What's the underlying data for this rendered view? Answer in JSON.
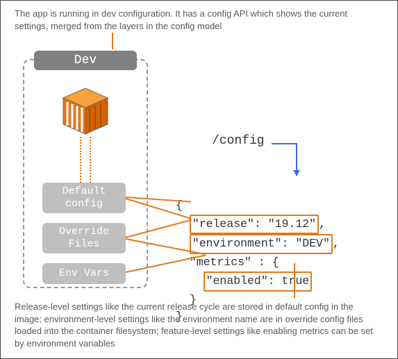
{
  "captions": {
    "top": "The app is running in dev configuration. It has a config API which shows the current settings, merged from the layers in the config model",
    "bottom": "Release-level settings like the current release cycle are stored in default config in the image; environment-level settings like the environment name are in override config files loaded into the container filesystem; feature-level settings like enabling metrics can be set by environment variables"
  },
  "labels": {
    "dev": "Dev",
    "default_config": "Default config",
    "override_files": "Override Files",
    "env_vars": "Env Vars",
    "endpoint": "/config"
  },
  "json": {
    "open": "{",
    "release": "\"release\": \"19.12\"",
    "release_comma": ",",
    "environment": "\"environment\": \"DEV\"",
    "environment_comma": ",",
    "metrics": "\"metrics\" : {",
    "enabled": "\"enabled\": true",
    "metrics_close": "}",
    "close": "}"
  },
  "colors": {
    "accent": "#e67817",
    "pill": "#bfbfbf",
    "devpill": "#808080",
    "blue": "#3a6bd6"
  }
}
